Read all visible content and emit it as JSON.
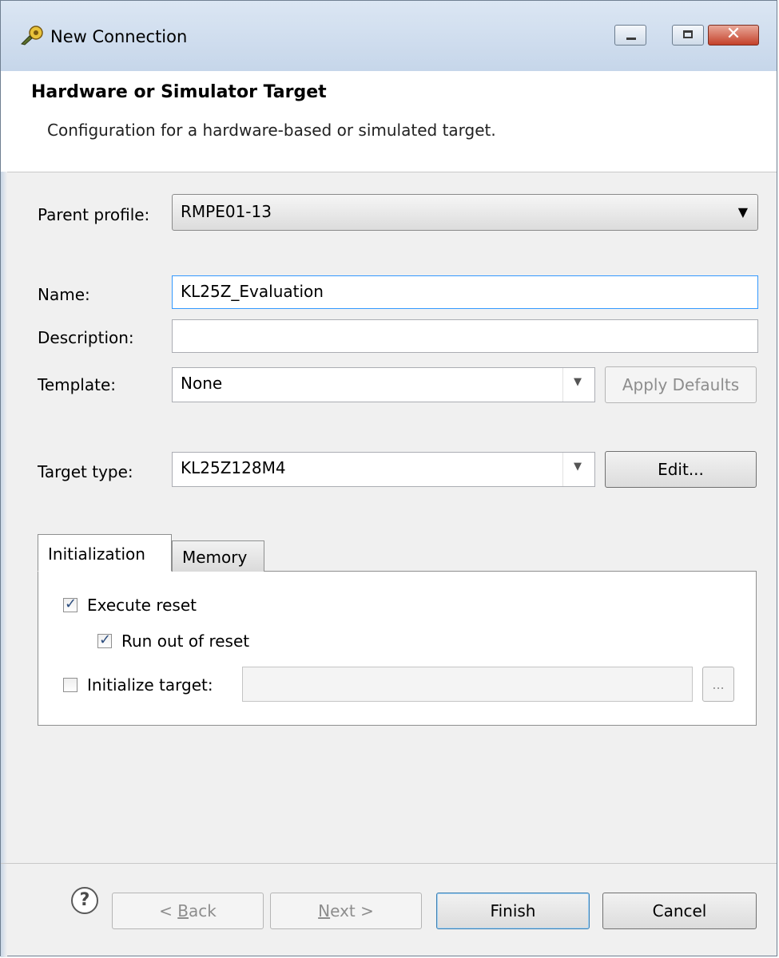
{
  "window": {
    "title": "New Connection",
    "close_glyph": "✕"
  },
  "header": {
    "title": "Hardware or Simulator Target",
    "description": "Configuration for a hardware-based or simulated target."
  },
  "form": {
    "parent_profile_label": "Parent profile:",
    "parent_profile_value": "RMPE01-13",
    "name_label": "Name:",
    "name_value": "KL25Z_Evaluation",
    "description_label": "Description:",
    "description_value": "",
    "template_label": "Template:",
    "template_value": "None",
    "apply_defaults_label": "Apply Defaults",
    "target_type_label": "Target type:",
    "target_type_value": "KL25Z128M4",
    "edit_label": "Edit..."
  },
  "tabs": {
    "items": [
      {
        "label": "Initialization",
        "selected": true
      },
      {
        "label": "Memory",
        "selected": false
      }
    ]
  },
  "initialization": {
    "execute_reset_label": "Execute reset",
    "execute_reset_checked": true,
    "run_out_of_reset_label": "Run out of reset",
    "run_out_of_reset_checked": true,
    "initialize_target_label": "Initialize target:",
    "initialize_target_checked": false,
    "initialize_target_value": "",
    "browse_label": "..."
  },
  "footer": {
    "help_label": "?",
    "back_prefix": "< ",
    "back_mnemonic": "B",
    "back_rest": "ack",
    "next_mnemonic": "N",
    "next_rest": "ext >",
    "finish_label": "Finish",
    "cancel_label": "Cancel"
  },
  "colors": {
    "titlebar": "#c6d6ea",
    "close_button": "#c4412a",
    "focus_border": "#3399ff",
    "default_button_border": "#3c7fb1"
  },
  "icons": {
    "app": "connection-icon",
    "minimize": "minimize-icon",
    "maximize": "maximize-icon",
    "close": "close-icon",
    "dropdown": "chevron-down-icon",
    "check": "checkmark-icon",
    "help": "help-icon"
  }
}
